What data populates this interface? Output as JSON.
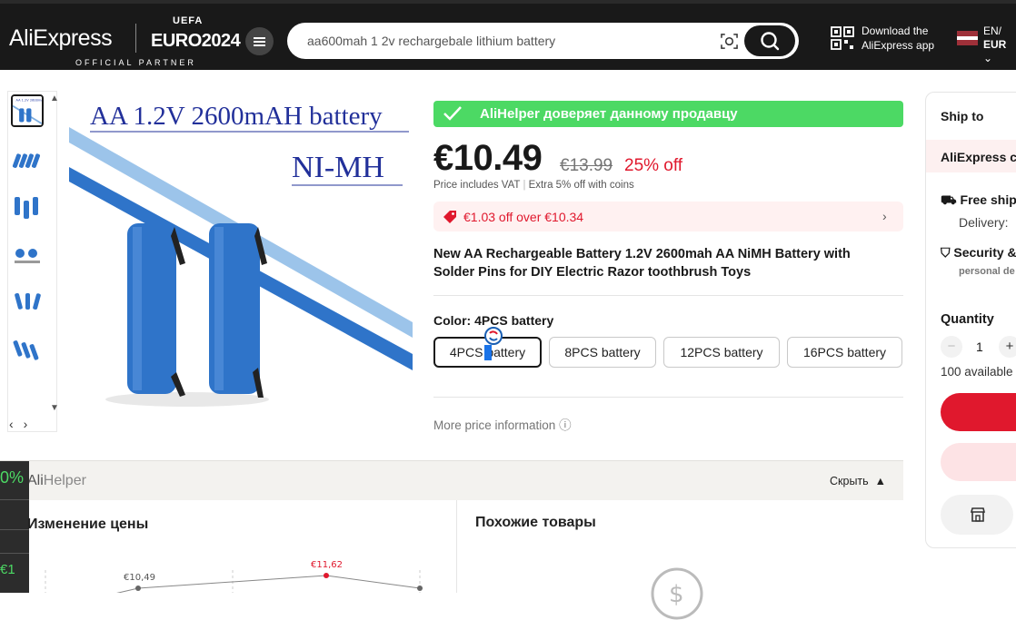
{
  "header": {
    "logo": "AliExpress",
    "uefa": "UEFA",
    "euro": "EURO2024",
    "official_partner": "OFFICIAL PARTNER",
    "search_value": "aa600mah 1 2v rechargebale lithium battery",
    "download_line1": "Download the",
    "download_line2": "AliExpress app",
    "lang": "EN/",
    "currency": "EUR"
  },
  "gallery": {
    "image_title": "AA 1.2V 2600mAH battery",
    "image_subtitle": "NI-MH"
  },
  "product": {
    "alihelper_banner": "AliHelper доверяет данному продавцу",
    "price": "€10.49",
    "old_price": "€13.99",
    "discount": "25% off",
    "vat_note": "Price includes VAT",
    "coins_note": "Extra 5% off with coins",
    "coupon": "€1.03 off over €10.34",
    "title": "New AA Rechargeable Battery 1.2V 2600mah AA NiMH Battery with Solder Pins for DIY Electric Razor toothbrush Toys",
    "color_label": "Color: 4PCS battery",
    "options": [
      "4PCS battery",
      "8PCS battery",
      "12PCS battery",
      "16PCS battery"
    ],
    "more_price": "More price information"
  },
  "alihelper": {
    "name_prefix": "Ali",
    "name_suffix": "Helper",
    "hide": "Скрыть",
    "price_change": "Изменение цены",
    "similar": "Похожие товары",
    "side_pct": "0%",
    "side_val": "€1",
    "chart_labels": [
      "€10,49",
      "€11,62"
    ]
  },
  "right_panel": {
    "ship_to": "Ship to",
    "carrier": "AliExpress co",
    "free_ship": "Free ship",
    "delivery": "Delivery:",
    "security": "Security &",
    "personal": "personal de",
    "quantity_label": "Quantity",
    "qty_minus": "−",
    "quantity": "1",
    "qty_plus": "+",
    "available": "100 available"
  },
  "colors": {
    "accent_red": "#e0182d",
    "alihelper_green": "#4cd964",
    "header_bg": "#191919"
  }
}
